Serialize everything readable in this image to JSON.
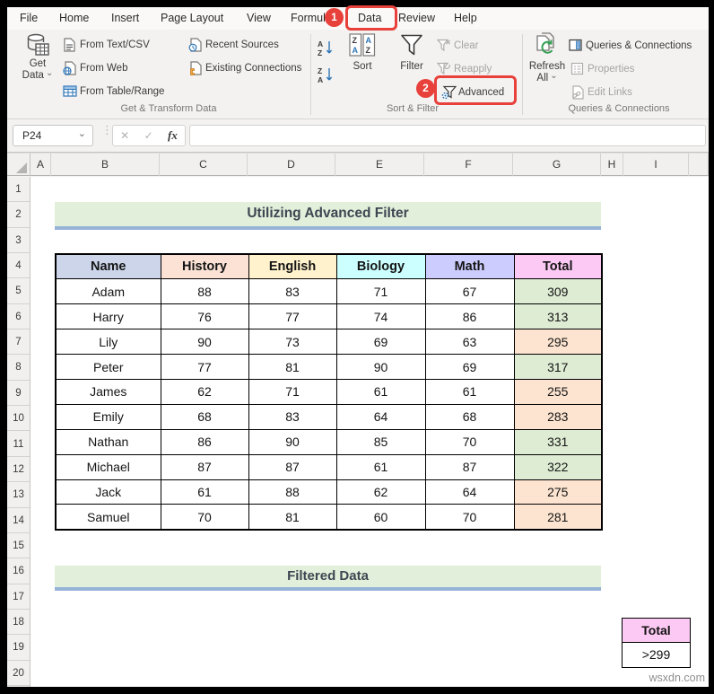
{
  "menu": {
    "tabs": [
      "File",
      "Home",
      "Insert",
      "Page Layout",
      "View",
      "Formulas",
      "Data",
      "Review",
      "Help"
    ]
  },
  "annotations": {
    "step1": "1",
    "step2": "2"
  },
  "ribbon": {
    "get_data_line1": "Get",
    "get_data_line2": "Data",
    "from_text_csv": "From Text/CSV",
    "from_web": "From Web",
    "from_table_range": "From Table/Range",
    "recent_sources": "Recent Sources",
    "existing_connections": "Existing Connections",
    "group1_label": "Get & Transform Data",
    "sort": "Sort",
    "filter": "Filter",
    "clear": "Clear",
    "reapply": "Reapply",
    "advanced": "Advanced",
    "group2_label": "Sort & Filter",
    "refresh_line1": "Refresh",
    "refresh_line2": "All",
    "queries_connections": "Queries & Connections",
    "properties": "Properties",
    "edit_links": "Edit Links",
    "group3_label": "Queries & Connections"
  },
  "formula_bar": {
    "name_box": "P24",
    "formula": ""
  },
  "glyphs": {
    "dots": "⋮",
    "cancel": "✕",
    "enter": "✓",
    "fx": "fx"
  },
  "grid": {
    "columns": [
      "A",
      "B",
      "C",
      "D",
      "E",
      "F",
      "G",
      "H",
      "I"
    ],
    "rows": [
      "1",
      "2",
      "3",
      "4",
      "5",
      "6",
      "7",
      "8",
      "9",
      "10",
      "11",
      "12",
      "13",
      "14",
      "15",
      "16",
      "17",
      "18",
      "19",
      "20"
    ]
  },
  "sheet": {
    "title_banner": "Utilizing Advanced Filter",
    "filtered_banner": "Filtered Data",
    "table": {
      "columns": [
        {
          "label": "Name",
          "bg": "#ccd5ea"
        },
        {
          "label": "History",
          "bg": "#fbe2d5"
        },
        {
          "label": "English",
          "bg": "#fff2cc"
        },
        {
          "label": "Biology",
          "bg": "#ccffff"
        },
        {
          "label": "Math",
          "bg": "#ccccff"
        },
        {
          "label": "Total",
          "bg": "#fbc9f3"
        }
      ],
      "rows": [
        {
          "name": "Adam",
          "history": "88",
          "english": "83",
          "biology": "71",
          "math": "67",
          "total": "309",
          "total_bg": "#deecd3"
        },
        {
          "name": "Harry",
          "history": "76",
          "english": "77",
          "biology": "74",
          "math": "86",
          "total": "313",
          "total_bg": "#deecd3"
        },
        {
          "name": "Lily",
          "history": "90",
          "english": "73",
          "biology": "69",
          "math": "63",
          "total": "295",
          "total_bg": "#fce4d0"
        },
        {
          "name": "Peter",
          "history": "77",
          "english": "81",
          "biology": "90",
          "math": "69",
          "total": "317",
          "total_bg": "#deecd3"
        },
        {
          "name": "James",
          "history": "62",
          "english": "71",
          "biology": "61",
          "math": "61",
          "total": "255",
          "total_bg": "#fce4d0"
        },
        {
          "name": "Emily",
          "history": "68",
          "english": "83",
          "biology": "64",
          "math": "68",
          "total": "283",
          "total_bg": "#fce4d0"
        },
        {
          "name": "Nathan",
          "history": "86",
          "english": "90",
          "biology": "85",
          "math": "70",
          "total": "331",
          "total_bg": "#deecd3"
        },
        {
          "name": "Michael",
          "history": "87",
          "english": "87",
          "biology": "61",
          "math": "87",
          "total": "322",
          "total_bg": "#deecd3"
        },
        {
          "name": "Jack",
          "history": "61",
          "english": "88",
          "biology": "62",
          "math": "64",
          "total": "275",
          "total_bg": "#fce4d0"
        },
        {
          "name": "Samuel",
          "history": "70",
          "english": "81",
          "biology": "60",
          "math": "70",
          "total": "281",
          "total_bg": "#fce4d0"
        }
      ]
    },
    "criteria": {
      "header": "Total",
      "header_bg": "#fbc9f3",
      "value": ">299"
    },
    "watermark": "wsxdn.com"
  },
  "colors": {
    "annotation_red": "#e8403a",
    "banner_green": "#e2efda",
    "banner_underline": "#97b4d8",
    "total_pass_green": "#deecd3",
    "total_fail_peach": "#fce4d0"
  }
}
